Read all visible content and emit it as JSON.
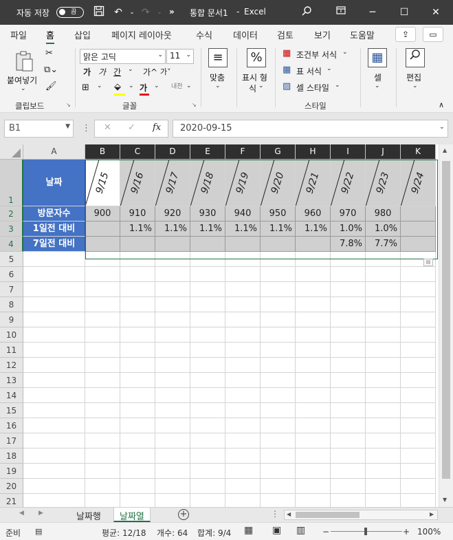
{
  "titlebar": {
    "autosave_label": "자동 저장",
    "toggle_state": "끔",
    "document_title": "통합 문서1",
    "separator": "-",
    "app_name": "Excel",
    "overflow": "»"
  },
  "ribbon_tabs": [
    "파일",
    "홈",
    "삽입",
    "페이지 레이아웃",
    "수식",
    "데이터",
    "검토",
    "보기",
    "도움말"
  ],
  "active_tab": "홈",
  "ribbon": {
    "clipboard": {
      "paste_label": "붙여넣기",
      "group_label": "클립보드"
    },
    "font": {
      "font_name": "맑은 고딕",
      "font_size": "11",
      "bold": "가",
      "increase": "가",
      "decrease": "가",
      "underline": "간",
      "grow": "가^",
      "shrink": "가˅",
      "color_letter": "가",
      "group_label": "글꼴"
    },
    "alignment": {
      "label": "맞춤"
    },
    "number": {
      "label_line1": "표시 형",
      "label_line2": "식",
      "icon": "%"
    },
    "styles": {
      "conditional": "조건부 서식",
      "table": "표 서식",
      "cell_style": "셀 스타일",
      "group_label": "스타일"
    },
    "cells": {
      "label": "셀"
    },
    "editing": {
      "label": "편집"
    }
  },
  "formula_bar": {
    "name_box": "B1",
    "cancel": "✕",
    "enter": "✓",
    "fx": "fx",
    "value": "2020-09-15"
  },
  "grid": {
    "columns": [
      "A",
      "B",
      "C",
      "D",
      "E",
      "F",
      "G",
      "H",
      "I",
      "J",
      "K"
    ],
    "rows": [
      "1",
      "2",
      "3",
      "4",
      "5",
      "6",
      "7",
      "8",
      "9",
      "10",
      "11",
      "12",
      "13",
      "14",
      "15",
      "16",
      "17",
      "18",
      "19",
      "20",
      "21"
    ],
    "row_headers": [
      "날짜",
      "방문자수",
      "1일전 대비",
      "7일전 대비"
    ],
    "dates": [
      "9/15",
      "9/16",
      "9/17",
      "9/18",
      "9/19",
      "9/20",
      "9/21",
      "9/22",
      "9/23",
      "9/24"
    ],
    "visitors": [
      "900",
      "910",
      "920",
      "930",
      "940",
      "950",
      "960",
      "970",
      "980",
      ""
    ],
    "day_change": [
      "",
      "1.1%",
      "1.1%",
      "1.1%",
      "1.1%",
      "1.1%",
      "1.1%",
      "1.0%",
      "1.0%",
      ""
    ],
    "week_change": [
      "",
      "",
      "",
      "",
      "",
      "",
      "",
      "7.8%",
      "7.7%",
      ""
    ]
  },
  "sheets": {
    "tabs": [
      "날짜행",
      "날짜열"
    ],
    "active": "날짜열",
    "add": "+"
  },
  "status": {
    "ready": "준비",
    "average": "평균: 12/18",
    "count": "개수: 64",
    "sum": "합계: 9/4",
    "zoom": "100%",
    "minus": "−",
    "plus": "+"
  },
  "colors": {
    "header_fill": "#4472c4",
    "date_fill": "#d0d0d0",
    "accent": "#217346",
    "titlebar": "#3c3c3c"
  }
}
